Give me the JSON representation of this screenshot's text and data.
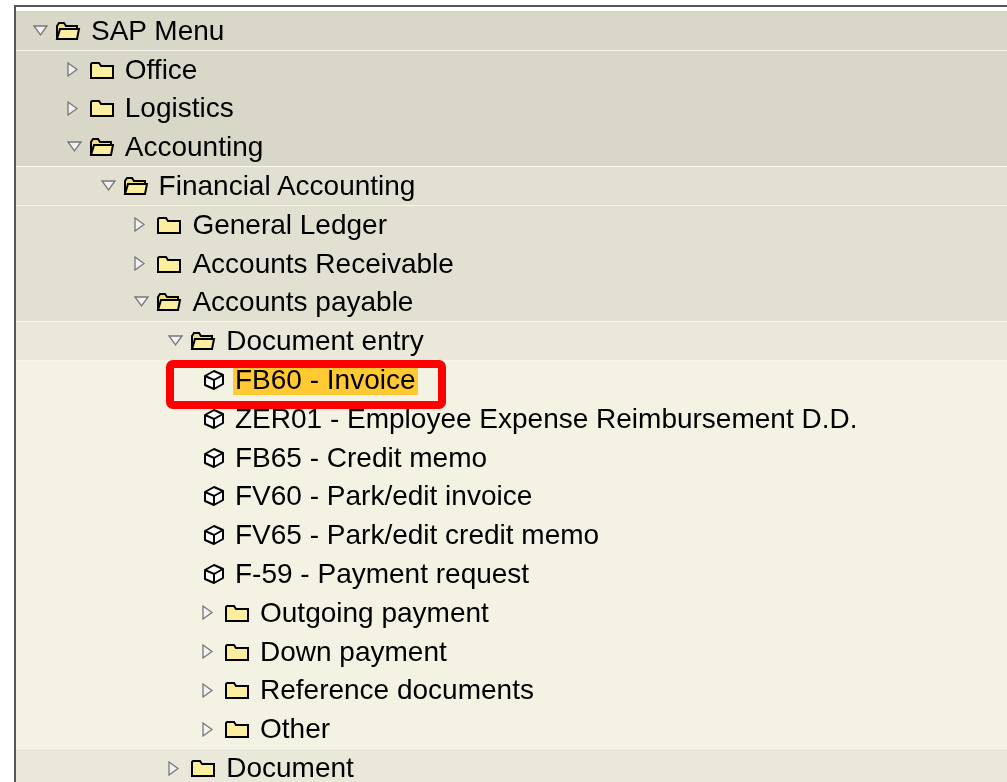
{
  "tree": [
    {
      "label": "SAP Menu",
      "kind": "folder",
      "expanded": true,
      "children": [
        {
          "label": "Office",
          "kind": "folder",
          "expanded": false
        },
        {
          "label": "Logistics",
          "kind": "folder",
          "expanded": false
        },
        {
          "label": "Accounting",
          "kind": "folder",
          "expanded": true,
          "children": [
            {
              "label": "Financial Accounting",
              "kind": "folder",
              "expanded": true,
              "children": [
                {
                  "label": "General Ledger",
                  "kind": "folder",
                  "expanded": false
                },
                {
                  "label": "Accounts Receivable",
                  "kind": "folder",
                  "expanded": false
                },
                {
                  "label": "Accounts payable",
                  "kind": "folder",
                  "expanded": true,
                  "children": [
                    {
                      "label": "Document entry",
                      "kind": "folder",
                      "expanded": true,
                      "children": [
                        {
                          "label": "FB60 - Invoice",
                          "kind": "transaction",
                          "selected": true,
                          "annotated": true
                        },
                        {
                          "label": "ZER01 - Employee Expense Reimbursement D.D.",
                          "kind": "transaction",
                          "selected": false,
                          "annotated": false
                        },
                        {
                          "label": "FB65 - Credit memo",
                          "kind": "transaction",
                          "selected": false,
                          "annotated": false
                        },
                        {
                          "label": "FV60 - Park/edit invoice",
                          "kind": "transaction",
                          "selected": false,
                          "annotated": false
                        },
                        {
                          "label": "FV65 - Park/edit credit memo",
                          "kind": "transaction",
                          "selected": false,
                          "annotated": false
                        },
                        {
                          "label": "F-59 - Payment request",
                          "kind": "transaction",
                          "selected": false,
                          "annotated": false
                        },
                        {
                          "label": "Outgoing payment",
                          "kind": "folder",
                          "expanded": false
                        },
                        {
                          "label": "Down payment",
                          "kind": "folder",
                          "expanded": false
                        },
                        {
                          "label": "Reference documents",
                          "kind": "folder",
                          "expanded": false
                        },
                        {
                          "label": "Other",
                          "kind": "folder",
                          "expanded": false
                        }
                      ]
                    },
                    {
                      "label": "Document",
                      "kind": "folder",
                      "expanded": false
                    }
                  ]
                }
              ]
            }
          ]
        }
      ]
    }
  ]
}
